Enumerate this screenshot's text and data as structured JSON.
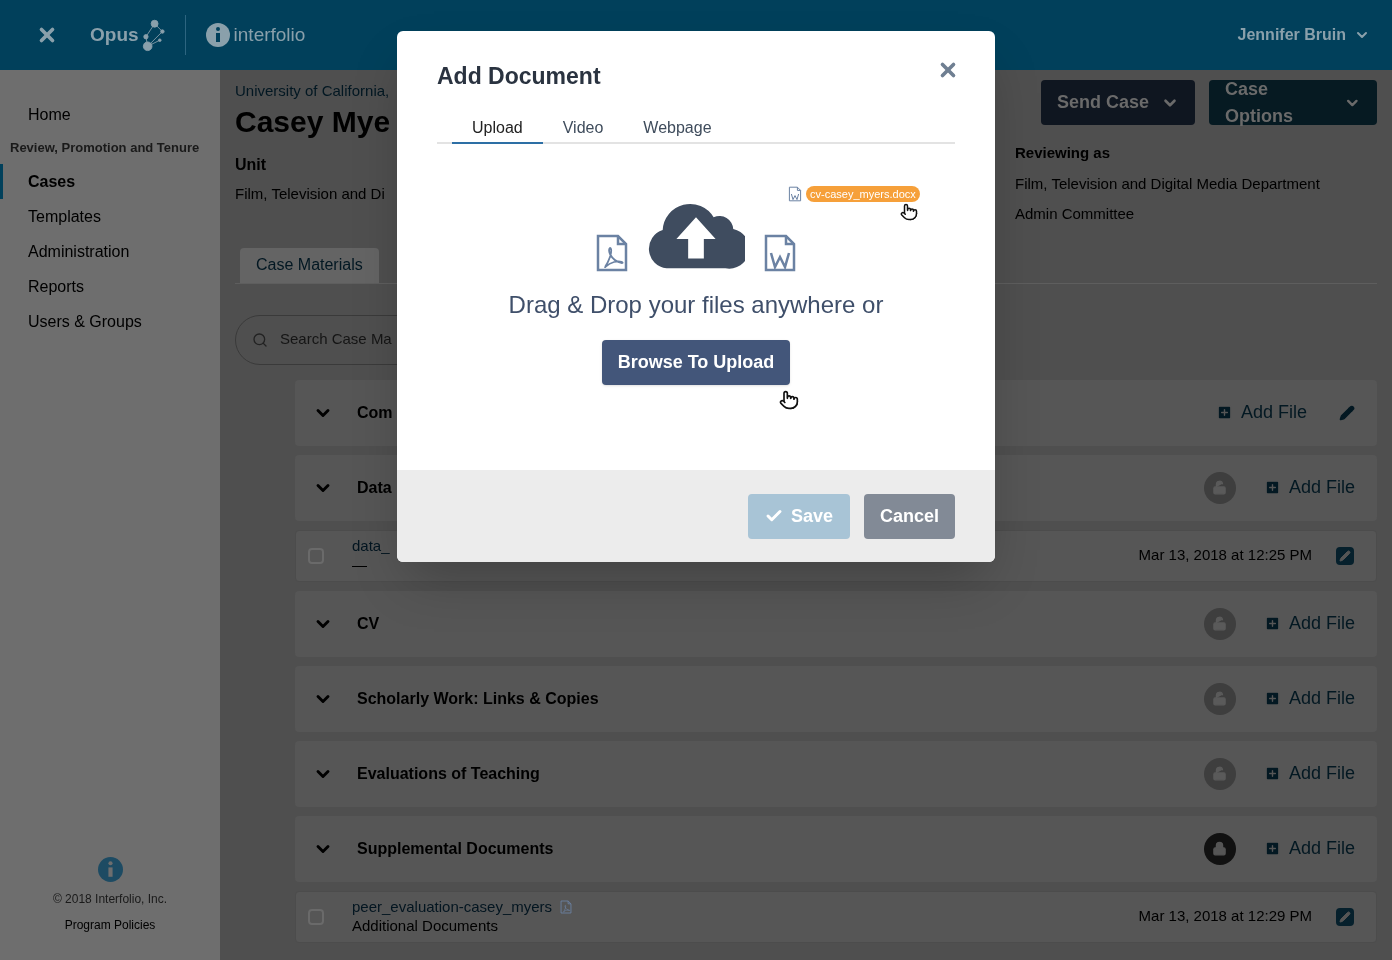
{
  "header": {
    "brand": "Opus",
    "partner": "interfolio",
    "user": "Jennifer Bruin"
  },
  "sidebar": {
    "items": [
      {
        "kind": "item",
        "label": "Home",
        "selected": false
      },
      {
        "kind": "heading",
        "label": "Review, Promotion and Tenure"
      },
      {
        "kind": "item",
        "label": "Cases",
        "selected": true
      },
      {
        "kind": "item",
        "label": "Templates",
        "selected": false
      },
      {
        "kind": "item",
        "label": "Administration",
        "selected": false
      },
      {
        "kind": "item",
        "label": "Reports",
        "selected": false
      },
      {
        "kind": "item",
        "label": "Users & Groups",
        "selected": false
      }
    ],
    "copyright": "© 2018 Interfolio, Inc.",
    "policies": "Program Policies"
  },
  "case": {
    "institution": "University of California,",
    "name": "Casey Mye",
    "unit_label": "Unit",
    "unit": "Film, Television and Di",
    "reviewing_label": "Reviewing as",
    "reviewing": [
      "Film, Television and Digital Media Department",
      "Admin Committee"
    ],
    "actions": [
      "Send Case",
      "Case Options"
    ],
    "tab": "Case Materials"
  },
  "search": {
    "placeholder": "Search Case Ma"
  },
  "sections": [
    {
      "kind": "section",
      "title": "Com",
      "add": "Add File",
      "editable": true
    },
    {
      "kind": "section",
      "title": "Data",
      "locked": false,
      "add": "Add File",
      "editable": false
    },
    {
      "kind": "file",
      "name": "data_",
      "note": "—",
      "date": "Mar 13, 2018 at 12:25 PM",
      "checked": false,
      "pdf": false
    },
    {
      "kind": "section",
      "title": "CV",
      "locked": false,
      "add": "Add File",
      "editable": false
    },
    {
      "kind": "section",
      "title": "Scholarly Work: Links & Copies",
      "locked": false,
      "add": "Add File",
      "editable": false
    },
    {
      "kind": "section",
      "title": "Evaluations of Teaching",
      "locked": false,
      "add": "Add File",
      "editable": false
    },
    {
      "kind": "section",
      "title": "Supplemental Documents",
      "locked": true,
      "add": "Add File",
      "editable": false
    },
    {
      "kind": "file",
      "name": "peer_evaluation-casey_myers",
      "note": "Additional Documents",
      "date": "Mar 13, 2018 at 12:29 PM",
      "checked": false,
      "pdf": true
    }
  ],
  "modal": {
    "title": "Add Document",
    "tabs": [
      {
        "label": "Upload",
        "selected": true
      },
      {
        "label": "Video",
        "selected": false
      },
      {
        "label": "Webpage",
        "selected": false
      }
    ],
    "dragged_file": "cv-casey_myers.docx",
    "prompt": "Drag & Drop your files anywhere or",
    "browse": "Browse To Upload",
    "save": {
      "label": "Save",
      "disabled": true
    },
    "cancel": "Cancel"
  }
}
